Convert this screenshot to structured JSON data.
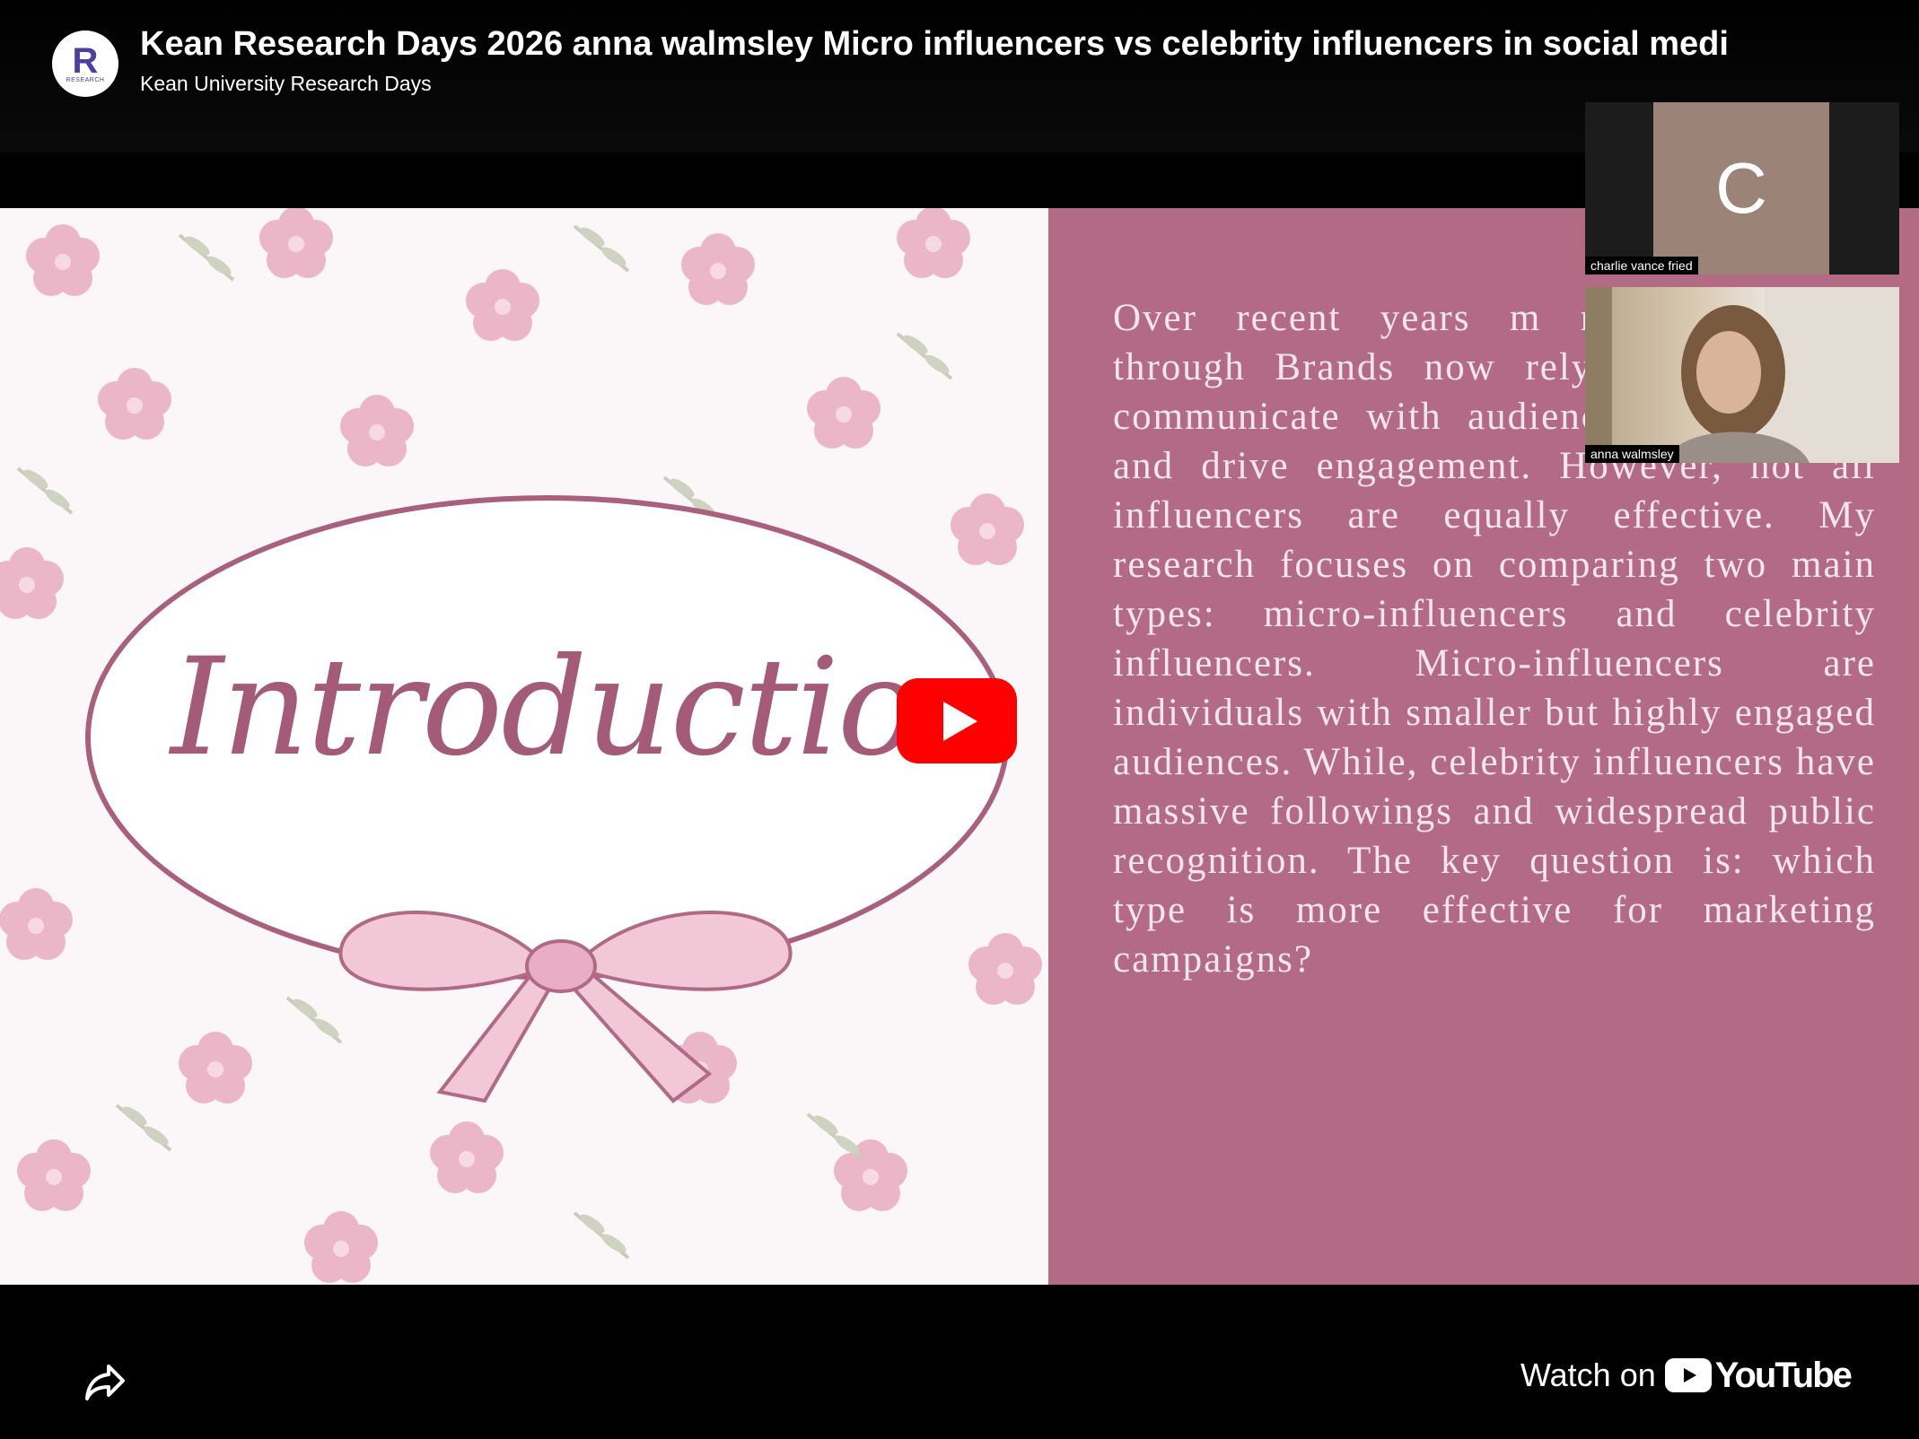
{
  "header": {
    "channel_logo_letter": "R",
    "channel_logo_caption": "RESEARCH",
    "title": "Kean Research Days 2026 anna walmsley Micro influencers vs celebrity influencers in social medi",
    "channel_name": "Kean University Research Days"
  },
  "slide": {
    "heading": "Introduction",
    "body": "Over recent years m rapidly evolved through Brands now rely influencers to communicate with audiences, build trust, and drive engagement. However, not all influencers are equally effective. My research focuses on comparing two main types: micro-influencers and celebrity influencers. Micro-influencers are individuals with smaller but highly engaged audiences. While, celebrity influencers have massive followings and widespread public recognition. The key question is: which type is more effective for marketing campaigns?",
    "left_bg": "#fbf7f8",
    "right_bg": "#b36a85",
    "accent": "#a35b78"
  },
  "participants": [
    {
      "initial": "C",
      "name": "charlie vance fried"
    },
    {
      "name": "anna walmsley"
    }
  ],
  "controls": {
    "play_icon": "play-icon",
    "share_icon": "share-icon",
    "watch_on_label": "Watch on",
    "youtube_label": "YouTube",
    "play_color": "#ff0000"
  }
}
